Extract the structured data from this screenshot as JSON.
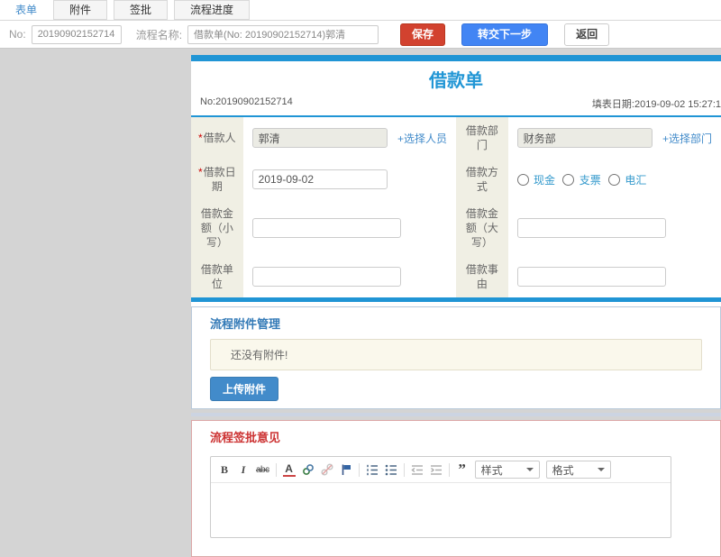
{
  "colors": {
    "accent_blue": "#2095d5",
    "link_blue": "#428bca",
    "save_red": "#d2422f",
    "next_blue": "#4285f4",
    "section_blue": "#337ab7",
    "section_red": "#cc3232",
    "label_bg": "#f0efe4"
  },
  "tabs": [
    {
      "label": "表单",
      "active": true
    },
    {
      "label": "附件",
      "active": false
    },
    {
      "label": "签批",
      "active": false
    },
    {
      "label": "流程进度",
      "active": false
    }
  ],
  "toolbar": {
    "no_label": "No:",
    "no_value": "20190902152714",
    "flow_label": "流程名称:",
    "flow_value": "借款单(No: 20190902152714)郭清",
    "save": "保存",
    "next": "转交下一步",
    "back": "返回"
  },
  "doc": {
    "title": "借款单",
    "no": "No:20190902152714",
    "fill_date": "填表日期:2019-09-02 15:27:1",
    "required_mark": "*"
  },
  "form": {
    "borrower": {
      "label": "借款人",
      "value": "郭清",
      "link": "+选择人员"
    },
    "department": {
      "label": "借款部门",
      "value": "财务部",
      "link": "+选择部门"
    },
    "borrow_date": {
      "label": "借款日期",
      "value": "2019-09-02"
    },
    "pay_method": {
      "label": "借款方式",
      "options": [
        "现金",
        "支票",
        "电汇"
      ]
    },
    "amount_lower": {
      "label": "借款金额（小写）",
      "value": ""
    },
    "amount_upper": {
      "label": "借款金额（大写）",
      "value": ""
    },
    "borrow_unit": {
      "label": "借款单位",
      "value": ""
    },
    "borrow_reason": {
      "label": "借款事由",
      "value": ""
    }
  },
  "attachments": {
    "title": "流程附件管理",
    "empty_text": "还没有附件!",
    "upload": "上传附件"
  },
  "approval": {
    "title": "流程签批意见",
    "editor": {
      "bold": "B",
      "italic": "I",
      "strike": "abc",
      "remove_format": "A",
      "quote": "”",
      "style_dropdown": "样式",
      "format_dropdown": "格式"
    }
  }
}
